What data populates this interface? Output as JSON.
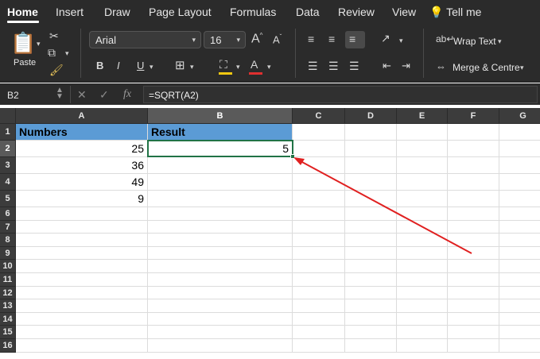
{
  "menu": {
    "tabs": [
      {
        "label": "Home",
        "active": true
      },
      {
        "label": "Insert"
      },
      {
        "label": "Draw"
      },
      {
        "label": "Page Layout"
      },
      {
        "label": "Formulas"
      },
      {
        "label": "Data"
      },
      {
        "label": "Review"
      },
      {
        "label": "View"
      }
    ],
    "tell_me": "Tell me"
  },
  "ribbon": {
    "paste_label": "Paste",
    "font_name": "Arial",
    "font_size": "16",
    "bold": "B",
    "italic": "I",
    "underline": "U",
    "grow": "A",
    "shrink": "A",
    "font_color": "A",
    "wrap_text": "Wrap Text",
    "merge_centre": "Merge & Centre",
    "highlight_color": "#f2c811",
    "font_color_value": "#e03030"
  },
  "formula_bar": {
    "name_box": "B2",
    "fx": "fx",
    "formula": "=SQRT(A2)"
  },
  "sheet": {
    "columns": [
      "A",
      "B",
      "C",
      "D",
      "E",
      "F",
      "G"
    ],
    "selected_column": "B",
    "selected_row": "2",
    "rows": [
      "1",
      "2",
      "3",
      "4",
      "5",
      "6",
      "7",
      "8",
      "9",
      "10",
      "11",
      "12",
      "13",
      "14",
      "15",
      "16"
    ],
    "header": {
      "a": "Numbers",
      "b": "Result"
    },
    "values_a": [
      "25",
      "36",
      "49",
      "9"
    ],
    "result_b2": "5",
    "header_fill": "#5b9bd5",
    "selection_color": "#217346",
    "annotation_arrow_color": "#e02020"
  }
}
